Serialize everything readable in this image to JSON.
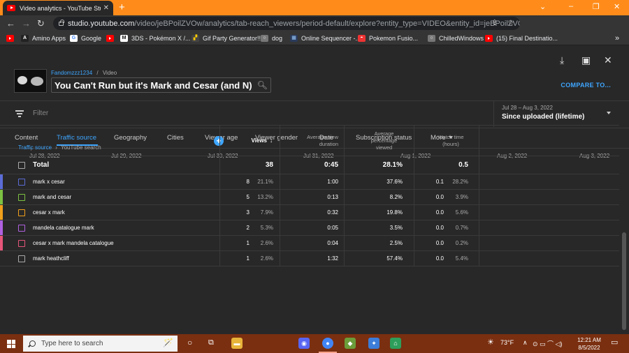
{
  "browser": {
    "tab_title": "Video analytics - YouTube Studio",
    "tab_close": "✕",
    "new_tab": "+",
    "window_controls": [
      "–",
      "❐",
      "✕"
    ],
    "url_host": "studio.youtube.com",
    "url_path": "/video/jeBPoilZVOw/analytics/tab-reach_viewers/period-default/explore?entity_type=VIDEO&entity_id=jeBPoilZVOw&ddr_dim...",
    "extensions": [
      {
        "icon": "abp-icon",
        "text": "ABP",
        "color": "#c70d2c"
      },
      {
        "icon": "shield-icon",
        "text": "",
        "color": "#5f8fbf"
      },
      {
        "icon": "camera-icon",
        "text": "",
        "color": "#888888"
      },
      {
        "icon": "screen-icon",
        "text": "",
        "color": "#bbbbbb"
      },
      {
        "icon": "puzzle-icon",
        "text": "",
        "color": "#dddddd"
      },
      {
        "icon": "sidebar-icon",
        "text": "",
        "color": "#dddddd"
      },
      {
        "icon": "profile-icon",
        "text": "",
        "color": "#2f9e6a"
      }
    ],
    "bookmarks": [
      {
        "label": "",
        "icon": "youtube-icon"
      },
      {
        "label": "Amino Apps",
        "icon": "amino-icon"
      },
      {
        "label": "Google",
        "icon": "google-icon"
      },
      {
        "label": "",
        "icon": "youtube-icon"
      },
      {
        "label": "3DS - Pokémon X /...",
        "icon": "m-icon"
      },
      {
        "label": "Gif Party Generator!!!",
        "icon": "gif-icon"
      },
      {
        "label": "dog",
        "icon": "globe-icon"
      },
      {
        "label": "Online Sequencer -...",
        "icon": "sequencer-icon"
      },
      {
        "label": "Pokemon Fusio...",
        "icon": "pokeball-icon"
      },
      {
        "label": "ChilledWindows",
        "icon": "globe-icon"
      },
      {
        "label": "(15) Final Destinatio...",
        "icon": "youtube-icon"
      }
    ],
    "bookmarks_more": "»"
  },
  "studio": {
    "channel": "Fandomzzz1234",
    "crumb_sep": "/",
    "crumb_video": "Video",
    "video_title": "You Can't Run but it's Mark and Cesar (and N)",
    "compare_label": "COMPARE TO...",
    "filter_placeholder": "Filter",
    "date_range": "Jul 28 – Aug 3, 2022",
    "date_value": "Since uploaded (lifetime)",
    "tabs": [
      "Content",
      "Traffic source",
      "Geography",
      "Cities",
      "Viewer age",
      "Viewer gender",
      "Date",
      "Subscription status",
      "More"
    ],
    "active_tab": "Traffic source",
    "chart_x_labels": [
      "Jul 28, 2022",
      "Jul 29, 2022",
      "Jul 30, 2022",
      "Jul 31, 2022",
      "Aug 1, 2022",
      "Aug 2, 2022",
      "Aug 3, 2022"
    ]
  },
  "table": {
    "breadcrumb_link": "Traffic source",
    "breadcrumb_sep": "›",
    "breadcrumb_current": "YouTube search",
    "add_metric": "+",
    "headers": {
      "views": "Views",
      "sort_arrow": "↓",
      "avg_view_duration": "Average view duration",
      "avg_pct_viewed": "Average percentage viewed",
      "watch_time": "Watch time (hours)"
    },
    "total": {
      "label": "Total",
      "views": "38",
      "avg_view_duration": "0:45",
      "avg_pct_viewed": "28.1%",
      "watch_time": "0.5"
    },
    "rows": [
      {
        "label": "mark x cesar",
        "views": "8",
        "views_pct": "21.1%",
        "avg_view_duration": "1:00",
        "avg_pct_viewed": "37.6%",
        "watch_time": "0.1",
        "watch_pct": "28.2%",
        "color": "#5b6cd6"
      },
      {
        "label": "mark and cesar",
        "views": "5",
        "views_pct": "13.2%",
        "avg_view_duration": "0:13",
        "avg_pct_viewed": "8.2%",
        "watch_time": "0.0",
        "watch_pct": "3.9%",
        "color": "#7cc142"
      },
      {
        "label": "cesar x mark",
        "views": "3",
        "views_pct": "7.9%",
        "avg_view_duration": "0:32",
        "avg_pct_viewed": "19.8%",
        "watch_time": "0.0",
        "watch_pct": "5.6%",
        "color": "#f0a01c"
      },
      {
        "label": "mandela catalogue mark",
        "views": "2",
        "views_pct": "5.3%",
        "avg_view_duration": "0:05",
        "avg_pct_viewed": "3.5%",
        "watch_time": "0.0",
        "watch_pct": "0.7%",
        "color": "#b061e0"
      },
      {
        "label": "cesar x mark mandela catalogue",
        "views": "1",
        "views_pct": "2.6%",
        "avg_view_duration": "0:04",
        "avg_pct_viewed": "2.5%",
        "watch_time": "0.0",
        "watch_pct": "0.2%",
        "color": "#e6557a"
      },
      {
        "label": "mark heathcliff",
        "views": "1",
        "views_pct": "2.6%",
        "avg_view_duration": "1:32",
        "avg_pct_viewed": "57.4%",
        "watch_time": "0.0",
        "watch_pct": "5.4%",
        "color": ""
      }
    ]
  },
  "taskbar": {
    "search_placeholder": "Type here to search",
    "weather": "73°F",
    "time": "12:21 AM",
    "date": "8/5/2022",
    "colors": {
      "bar": "#7a2f10",
      "accent": "#f9a38b"
    }
  }
}
